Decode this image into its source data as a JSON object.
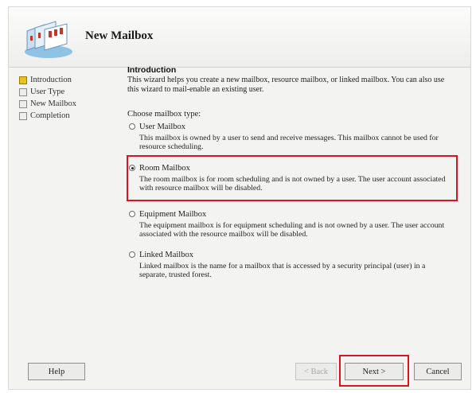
{
  "window": {
    "title": "New Mailbox"
  },
  "steps": [
    {
      "label": "Introduction",
      "active": true
    },
    {
      "label": "User Type",
      "active": false
    },
    {
      "label": "New Mailbox",
      "active": false
    },
    {
      "label": "Completion",
      "active": false
    }
  ],
  "intro": {
    "heading": "Introduction",
    "text": "This wizard helps you create a new mailbox, resource mailbox, or linked mailbox. You can also use this wizard to mail-enable an existing user."
  },
  "choose_label": "Choose mailbox type:",
  "options": [
    {
      "label": "User Mailbox",
      "checked": false,
      "description": "This mailbox is owned by a user to send and receive messages. This mailbox cannot be used for resource scheduling."
    },
    {
      "label": "Room Mailbox",
      "checked": true,
      "description": "The room mailbox is for room scheduling and is not owned by a user. The user account associated with resource mailbox will be disabled."
    },
    {
      "label": "Equipment Mailbox",
      "checked": false,
      "description": "The equipment mailbox is for equipment scheduling and is not owned by a user. The user account associated with the resource mailbox will be disabled."
    },
    {
      "label": "Linked Mailbox",
      "checked": false,
      "description": "Linked mailbox is the name for a mailbox that is accessed by a security principal (user) in a separate, trusted forest."
    }
  ],
  "buttons": {
    "help": "Help",
    "back": "< Back",
    "next": "Next >",
    "cancel": "Cancel"
  },
  "icons": {
    "header": "mailbox-icon"
  },
  "colors": {
    "highlight": "#d9151d",
    "active_step": "#e8c21f"
  }
}
